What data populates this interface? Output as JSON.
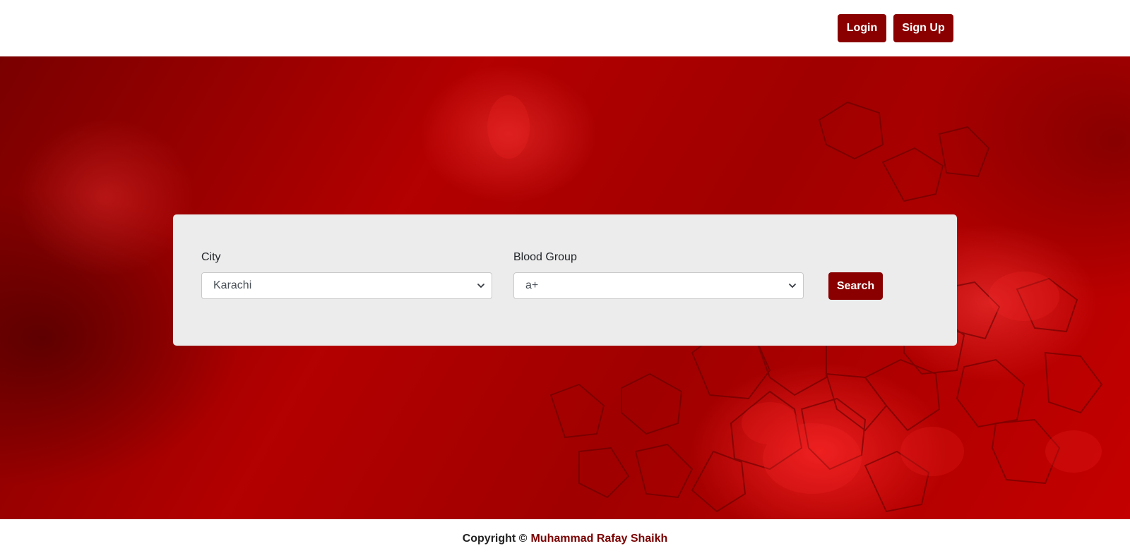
{
  "header": {
    "login_label": "Login",
    "signup_label": "Sign Up"
  },
  "search_form": {
    "city_label": "City",
    "city_value": "Karachi",
    "blood_group_label": "Blood Group",
    "blood_group_value": "a+",
    "search_label": "Search"
  },
  "footer": {
    "copyright_text": "Copyright ©",
    "author_name": "Muhammad Rafay Shaikh"
  },
  "colors": {
    "brand": "#8a0000",
    "card_background": "#ececec",
    "hero_tone": "#b30000"
  },
  "icons": {
    "dropdown": "chevron-down-icon"
  }
}
